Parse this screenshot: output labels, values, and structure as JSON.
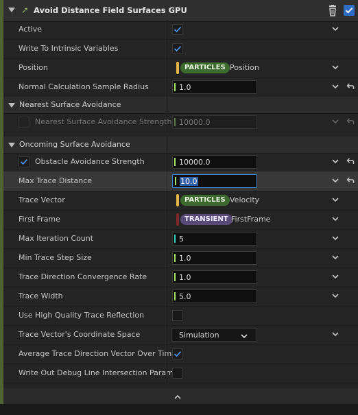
{
  "module": {
    "title": "Avoid Distance Field Surfaces GPU",
    "icon": "module-arrow-icon",
    "enabled": true
  },
  "rows_top": [
    {
      "label": "Active",
      "type": "checkbox",
      "checked": true
    },
    {
      "label": "Write To Intrinsic Variables",
      "type": "checkbox",
      "checked": true
    },
    {
      "label": "Position",
      "type": "binding",
      "namespace": "PARTICLES",
      "value": "Position"
    },
    {
      "label": "Normal Calculation Sample Radius",
      "type": "number",
      "value": "1.0",
      "reset": true
    }
  ],
  "categories": [
    {
      "label": "Nearest Surface Avoidance"
    },
    {
      "label": "Oncoming Surface Avoidance"
    }
  ],
  "nearest": {
    "label": "Nearest Surface Avoidance Strength",
    "value": "10000.0",
    "checked": false
  },
  "oncoming_rows": [
    {
      "label": "Obstacle Avoidance Strength",
      "value": "10000.0",
      "checked": true
    },
    {
      "label": "Max Trace Distance",
      "value": "10.0"
    },
    {
      "label": "Trace Vector",
      "namespace": "PARTICLES",
      "value": "Velocity"
    },
    {
      "label": "First Frame",
      "namespace": "TRANSIENT",
      "value": "FirstFrame"
    },
    {
      "label": "Max Iteration Count",
      "value": "5"
    },
    {
      "label": "Min Trace Step Size",
      "value": "1.0"
    },
    {
      "label": "Trace Direction Convergence Rate",
      "value": "1.0"
    },
    {
      "label": "Trace Width",
      "value": "5.0"
    },
    {
      "label": "Use High Quality Trace Reflection",
      "checked": false
    },
    {
      "label": "Trace Vector's Coordinate Space",
      "value": "Simulation"
    },
    {
      "label": "Average Trace Direction Vector Over Time",
      "checked": true
    },
    {
      "label": "Write Out Debug Line Intersection Parame",
      "checked": false
    }
  ],
  "colors": {
    "accent": "#2f6cc4",
    "particles_pill": "#3c6a2e",
    "transient_pill": "#5a4a78",
    "float_pin": "#9fe36a",
    "int_pin": "#34d1c1",
    "vector_pin": "#e3b54b"
  }
}
